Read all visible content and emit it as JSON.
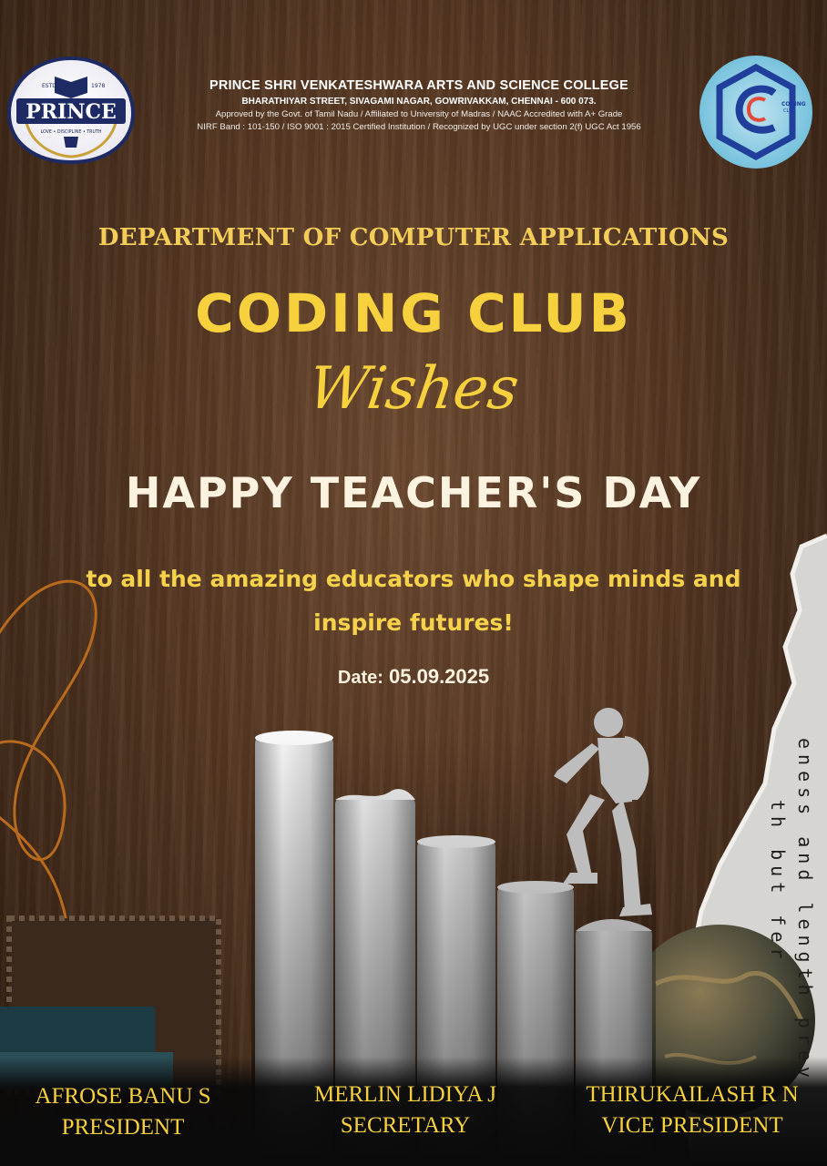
{
  "header": {
    "left_logo": {
      "top_small": "ESTD",
      "year": "1978",
      "name": "PRINCE",
      "motto": "LOVE • DISCIPLINE • TRUTH",
      "icon": "crest-icon"
    },
    "college_name": "PRINCE SHRI VENKATESHWARA ARTS AND SCIENCE COLLEGE",
    "address": "BHARATHIYAR STREET, SIVAGAMI NAGAR, GOWRIVAKKAM, CHENNAI - 600 073.",
    "approval": "Approved by the Govt. of Tamil Nadu / Affiliated to University of Madras / NAAC Accredited with A+ Grade",
    "certification": "NIRF Band : 101-150 / ISO 9001 : 2015 Certified Institution / Recognized by UGC under section 2(f) UGC Act 1956",
    "right_logo": {
      "label_top": "CODING",
      "label_bottom": "CLUB",
      "icon": "coding-club-logo-icon"
    }
  },
  "department": "DEPARTMENT OF COMPUTER APPLICATIONS",
  "club_title": "CODING CLUB",
  "wishes": "Wishes",
  "occasion": "HAPPY TEACHER'S DAY",
  "message_line1": "to all the amazing educators who shape minds and",
  "message_line2": "inspire futures!",
  "date": {
    "label": "Date:",
    "value": "05.09.2025"
  },
  "paper_text": {
    "col1": "eness and length prev",
    "col2": "th but fer"
  },
  "members": [
    {
      "name": "AFROSE BANU S",
      "role": "PRESIDENT"
    },
    {
      "name": "MERLIN LIDIYA J",
      "role": "SECRETARY"
    },
    {
      "name": "THIRUKAILASH R N",
      "role": "VICE PRESIDENT"
    }
  ],
  "colors": {
    "accent_yellow": "#f6d03d",
    "cream": "#fbf2e0",
    "wood_brown": "#553722"
  }
}
